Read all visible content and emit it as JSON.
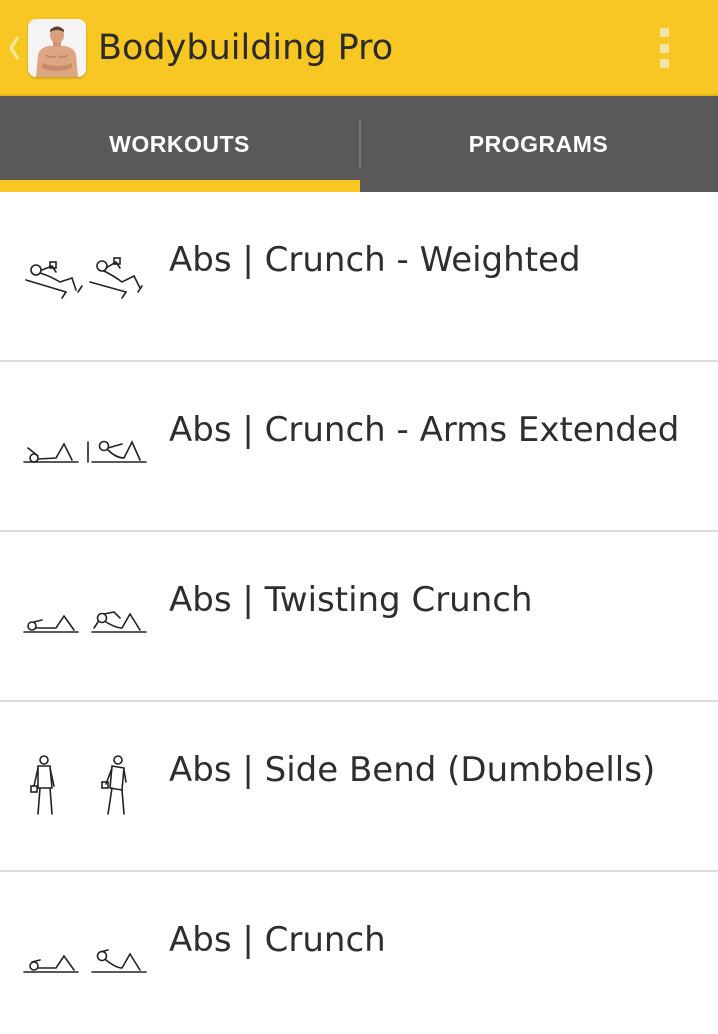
{
  "app": {
    "title": "Bodybuilding Pro",
    "accent_color": "#f9c723",
    "tabbar_color": "#595959"
  },
  "actionbar": {
    "back_icon": "chevron-left-icon",
    "app_icon": "app-logo-muscular-man",
    "overflow_icon": "overflow-menu-icon"
  },
  "tabs": [
    {
      "label": "WORKOUTS",
      "selected": true
    },
    {
      "label": "PROGRAMS",
      "selected": false
    }
  ],
  "workouts": [
    {
      "title": "Abs | Crunch - Weighted",
      "thumbnail": "weighted-crunch-illustration"
    },
    {
      "title": "Abs | Crunch - Arms Extended",
      "thumbnail": "arms-extended-crunch-illustration"
    },
    {
      "title": "Abs | Twisting Crunch",
      "thumbnail": "twisting-crunch-illustration"
    },
    {
      "title": "Abs | Side Bend (Dumbbells)",
      "thumbnail": "side-bend-illustration"
    },
    {
      "title": "Abs | Crunch",
      "thumbnail": "crunch-illustration"
    }
  ]
}
